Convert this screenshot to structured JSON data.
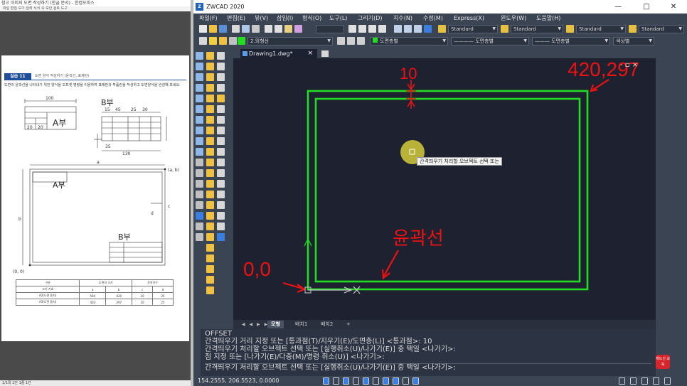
{
  "doc_viewer": {
    "title": "참고 이미지 도면 작성하기 (한글 문서) - 한컴오피스",
    "menu": "파일  편집  보기  입력  서식  쪽  보안  검토  도구",
    "section_badge": "실습 11",
    "section_title": "도면 양식 작성하기 (윤곽선, 표제란)",
    "description": "도면의 윤곽선을 나타내기 위한 양식을 오프셋 명령을 이용하여 표제란과 부품란을 작성하고 도면양식을 완성해 보세요.",
    "part_a_label": "A부",
    "part_b_label": "B부",
    "dim_100": "100",
    "dim_20a": "20",
    "dim_20b": "20",
    "dim_15": "15",
    "dim_45": "45",
    "dim_25": "25",
    "dim_30": "30",
    "dim_35": "35",
    "dim_130": "130",
    "dim_a": "a",
    "dim_ab": "(a, b)",
    "dim_d": "d",
    "dim_c": "c",
    "dim_b": "b",
    "origin_label": "(0, 0)",
    "table": {
      "headers": [
        "구분",
        "도면의 크기",
        "",
        "윤곽치수",
        ""
      ],
      "subheaders": [
        "크기·기호",
        "a",
        "b",
        "c",
        "d"
      ],
      "rows": [
        [
          "A2(도면 용지)",
          "594",
          "420",
          "10",
          "25"
        ],
        [
          "A3(도면 용지)",
          "420",
          "297",
          "10",
          "25"
        ]
      ]
    },
    "status": "1/1쪽  1단  1줄 1칸"
  },
  "cad": {
    "app_title": "ZWCAD 2020",
    "logo_text": "Z",
    "window_buttons": [
      "—",
      "□",
      "✕"
    ],
    "menu": [
      "파일(F)",
      "편집(E)",
      "뷰(V)",
      "삽입(I)",
      "형식(O)",
      "도구(L)",
      "그리기(D)",
      "치수(N)",
      "수정(M)",
      "Express(X)",
      "윈도우(W)",
      "도움말(H)"
    ],
    "toolbar_row1": {
      "text_style": "Standard",
      "dim_style": "Standard",
      "table_style": "Standard",
      "multileader_style": "Standard"
    },
    "toolbar_row2": {
      "layer": "2.외형선",
      "color": "도면층별",
      "linetype": "도면층별",
      "lineweight": "도면층별",
      "plot_style": "색상별"
    },
    "document_tab": "Drawing1.dwg*",
    "tab_close": "×",
    "canvas_controls": "- ▫ ×",
    "annotations": {
      "offset_value": "10",
      "corner_coords": "420,297",
      "border_label": "윤곽선",
      "origin_coords": "0,0"
    },
    "tooltip": "간격띄우기 처리할 오브젝트 선택 또는",
    "layout_nav": "◀ ◀ ▶ ▶",
    "layout_tabs": [
      "모형",
      "배치1",
      "배치2",
      "+"
    ],
    "command_lines": [
      "OFFSET",
      "간격띄우기 거리 지정 또는 [통과점(T)/지우기(E)/도면층(L)] <통과점>: 10",
      "간격띄우기 처리할 오브젝트 선택 또는 [실행취소(U)/나가기(E)] 중 택일 <나가기>:",
      "점 지정 또는 [나가기(E)/다중(M)/명령 취소(U)] <나가기>:",
      "간격띄우기 처리할 오브젝트 선택 또는 [실행취소(U)/나가기(E)] 중 택일 <나가기>:"
    ],
    "status_coords": "154.2555, 206.5523, 0.0000",
    "edu_badge": "캐드신 교육",
    "colors": {
      "canvas_bg": "#1e2230",
      "border_line": "#22dd22",
      "annotation": "#ee1111",
      "ui_bg": "#3b4453"
    }
  }
}
